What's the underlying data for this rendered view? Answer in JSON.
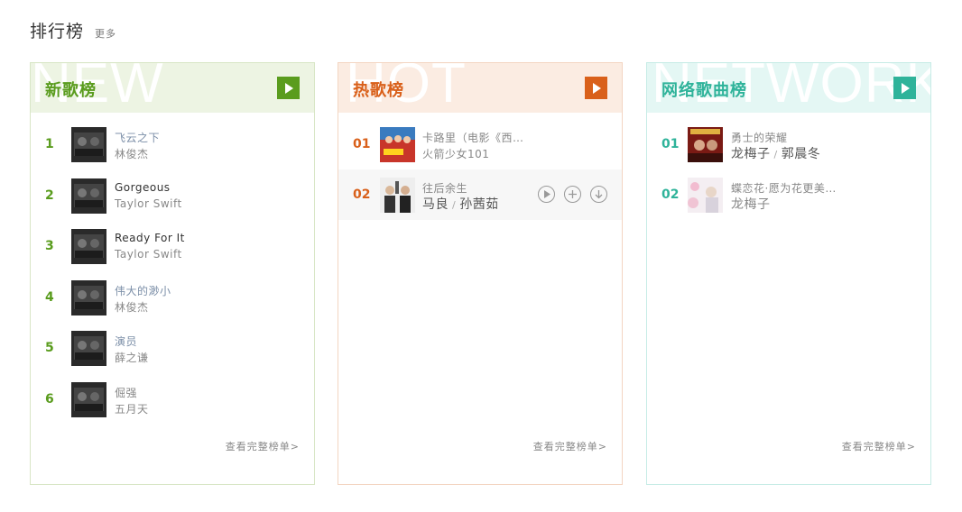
{
  "section": {
    "title": "排行榜",
    "more": "更多"
  },
  "cards": [
    {
      "bg_word": "NEW",
      "title": "新歌榜",
      "accent": "#5a9c1e",
      "head_bg": "#edf4e3",
      "border": "#d8e6c6",
      "full_link": "查看完整榜单>",
      "rows": [
        {
          "rank": "1",
          "song": "飞云之下",
          "singer": "林俊杰"
        },
        {
          "rank": "2",
          "song": "Gorgeous",
          "singer": "Taylor Swift"
        },
        {
          "rank": "3",
          "song": "Ready For It",
          "singer": "Taylor Swift"
        },
        {
          "rank": "4",
          "song": "伟大的渺小",
          "singer": "林俊杰"
        },
        {
          "rank": "5",
          "song": "演员",
          "singer": "薛之谦"
        },
        {
          "rank": "6",
          "song": "倔强",
          "singer": "五月天"
        }
      ]
    },
    {
      "bg_word": "HOT",
      "title": "热歌榜",
      "accent": "#d9601a",
      "head_bg": "#fbece2",
      "border": "#f3d5c2",
      "full_link": "查看完整榜单>",
      "rows": [
        {
          "rank": "01",
          "song": "卡路里（电影《西…",
          "singer": "火箭少女101"
        },
        {
          "rank": "02",
          "song": "往后余生",
          "singer_a": "马良",
          "singer_sep": "/",
          "singer_b": "孙茜茹"
        }
      ]
    },
    {
      "bg_word": "NETWORK",
      "title": "网络歌曲榜",
      "accent": "#2fb39a",
      "head_bg": "#e4f7f4",
      "border": "#c7ece6",
      "full_link": "查看完整榜单>",
      "rows": [
        {
          "rank": "01",
          "song": "勇士的荣耀",
          "singer_a": "龙梅子",
          "singer_sep": "/",
          "singer_b": "郭晨冬"
        },
        {
          "rank": "02",
          "song": "蝶恋花·愿为花更美…",
          "singer": "龙梅子"
        }
      ]
    }
  ]
}
